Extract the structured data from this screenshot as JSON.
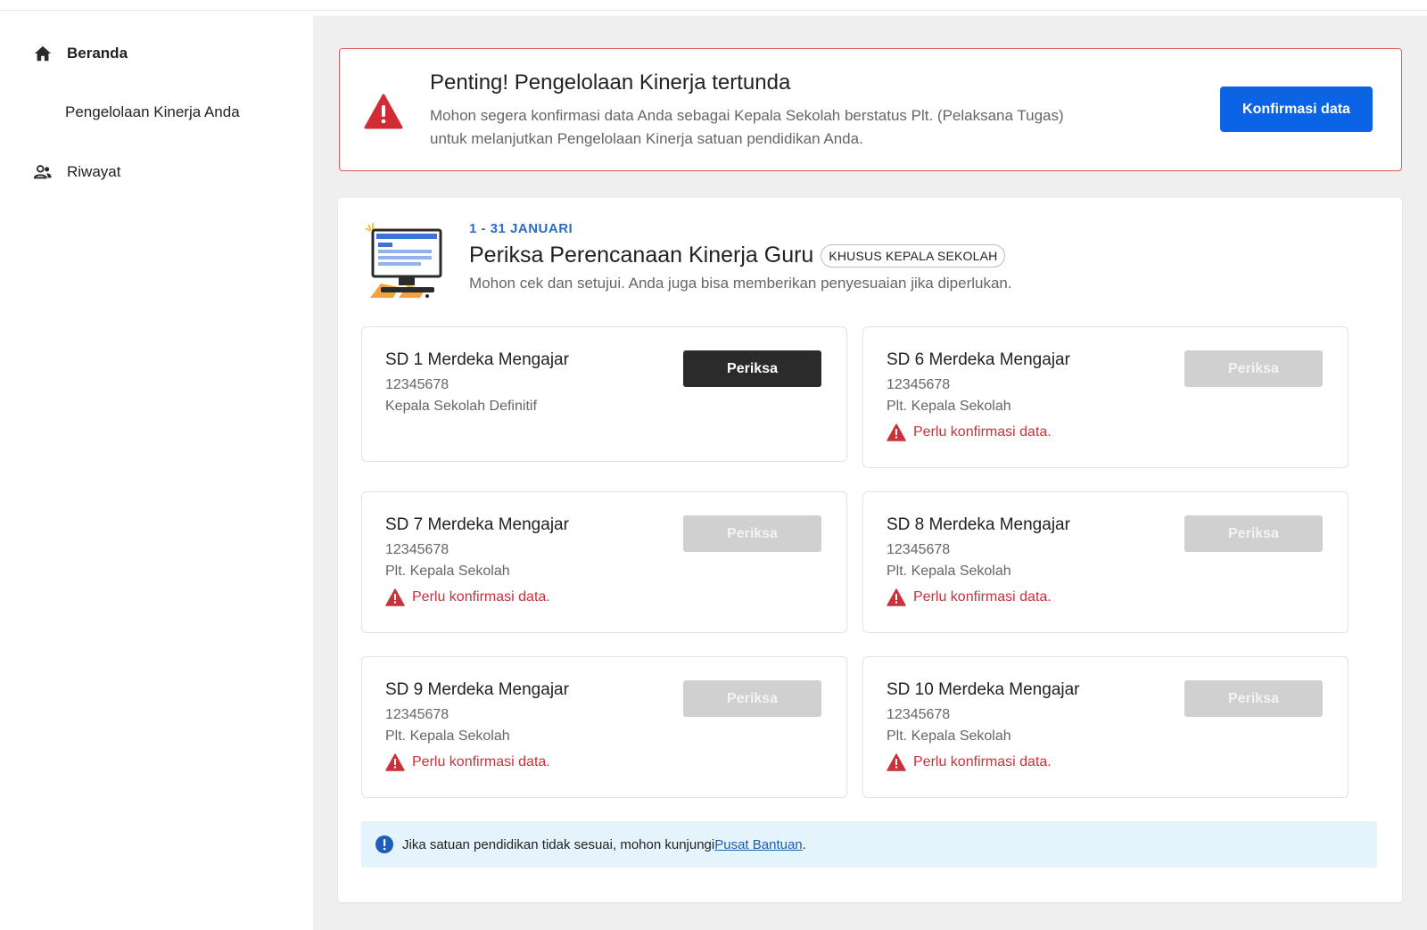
{
  "sidebar": {
    "items": [
      {
        "label": "Beranda",
        "icon": "home-icon"
      },
      {
        "label": "Pengelolaan Kinerja Anda"
      },
      {
        "label": "Riwayat",
        "icon": "people-icon"
      }
    ]
  },
  "alert": {
    "title": "Penting! Pengelolaan Kinerja tertunda",
    "text": "Mohon segera konfirmasi data Anda sebagai Kepala Sekolah berstatus Plt. (Pelaksana Tugas) untuk melanjutkan Pengelolaan Kinerja satuan pendidikan Anda.",
    "button": "Konfirmasi data",
    "icon": "warning-triangle-icon",
    "accent": "#e15a5a"
  },
  "panel": {
    "period": "1 - 31 JANUARI",
    "title": "Periksa Perencanaan Kinerja Guru",
    "badge": "KHUSUS KEPALA SEKOLAH",
    "subtitle": "Mohon cek dan setujui. Anda juga bisa memberikan penyesuaian jika diperlukan.",
    "illustration": "computer-illustration"
  },
  "cards": [
    {
      "name": "SD 1 Merdeka Mengajar",
      "id": "12345678",
      "role": "Kepala Sekolah Definitif",
      "button": "Periksa",
      "warning": ""
    },
    {
      "name": "SD 6 Merdeka Mengajar",
      "id": "12345678",
      "role": "Plt. Kepala Sekolah",
      "button": "Periksa",
      "warning": "Perlu konfirmasi data."
    },
    {
      "name": "SD 7 Merdeka Mengajar",
      "id": "12345678",
      "role": "Plt. Kepala Sekolah",
      "button": "Periksa",
      "warning": "Perlu konfirmasi data."
    },
    {
      "name": "SD 8 Merdeka Mengajar",
      "id": "12345678",
      "role": "Plt. Kepala Sekolah",
      "button": "Periksa",
      "warning": "Perlu konfirmasi data."
    },
    {
      "name": "SD 9 Merdeka Mengajar",
      "id": "12345678",
      "role": "Plt. Kepala Sekolah",
      "button": "Periksa",
      "warning": "Perlu konfirmasi data."
    },
    {
      "name": "SD 10 Merdeka Mengajar",
      "id": "12345678",
      "role": "Plt. Kepala Sekolah",
      "button": "Periksa",
      "warning": "Perlu konfirmasi data."
    }
  ],
  "info": {
    "text": "Jika satuan pendidikan tidak sesuai, mohon kunjungi ",
    "link": "Pusat Bantuan",
    "suffix": ".",
    "icon": "info-circle-icon"
  },
  "colors": {
    "primary": "#0b63e5",
    "dark_button": "#2b2b2b",
    "disabled_button": "#d0d0d0",
    "warning": "#c8323b",
    "period": "#2b6cc9",
    "info_bg": "#e4f3fc"
  }
}
